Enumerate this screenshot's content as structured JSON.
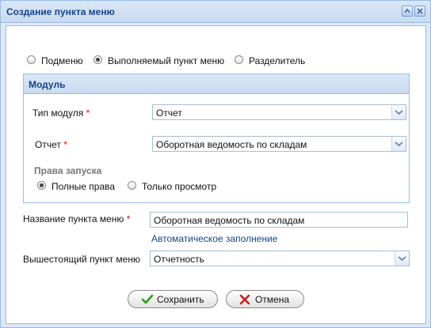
{
  "window": {
    "title": "Создание пункта меню"
  },
  "item_type": {
    "options": [
      {
        "label": "Подменю",
        "checked": false
      },
      {
        "label": "Выполняемый пункт меню",
        "checked": true
      },
      {
        "label": "Разделитель",
        "checked": false
      }
    ]
  },
  "module": {
    "title": "Модуль",
    "module_type": {
      "label": "Тип модуля",
      "required_mark": "*",
      "value": "Отчет"
    },
    "report": {
      "label": "Отчет",
      "required_mark": "*",
      "value": "Оборотная ведомость по складам"
    },
    "rights": {
      "title": "Права запуска",
      "options": [
        {
          "label": "Полные права",
          "checked": true
        },
        {
          "label": "Только просмотр",
          "checked": false
        }
      ]
    }
  },
  "menu_name": {
    "label": "Название пункта меню",
    "required_mark": "*",
    "value": "Оборотная ведомость по складам",
    "autofill_link": "Автоматическое заполнение"
  },
  "parent_item": {
    "label": "Вышестоящий пункт меню",
    "value": "Отчетность"
  },
  "buttons": {
    "save": "Сохранить",
    "cancel": "Отмена"
  },
  "colors": {
    "accent": "#15428b",
    "border": "#99bbe8",
    "required": "#ee0000",
    "save_icon": "#2e9e1f",
    "cancel_icon": "#d21f1f"
  }
}
